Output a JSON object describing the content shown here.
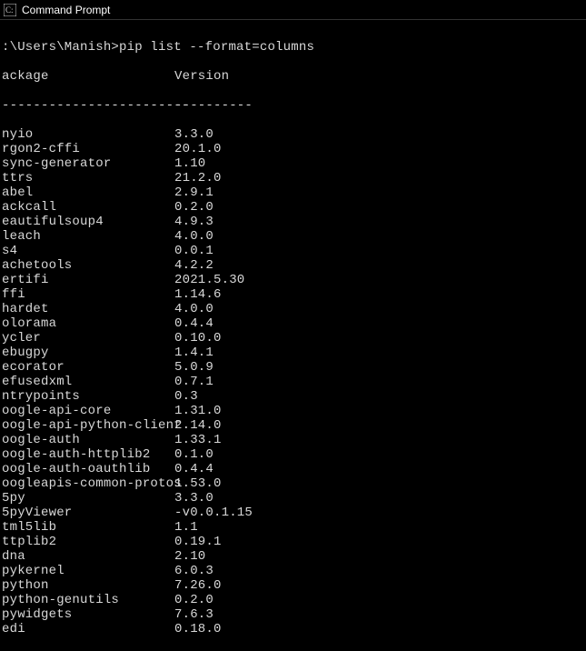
{
  "window": {
    "title": "Command Prompt"
  },
  "prompt": ":\\Users\\Manish>pip list --format=columns",
  "columns": {
    "package_header": "ackage",
    "version_header": "Version",
    "package_divider": "------------------------",
    "version_divider": "----------"
  },
  "packages": [
    {
      "name": "nyio",
      "version": "3.3.0"
    },
    {
      "name": "rgon2-cffi",
      "version": "20.1.0"
    },
    {
      "name": "sync-generator",
      "version": "1.10"
    },
    {
      "name": "ttrs",
      "version": "21.2.0"
    },
    {
      "name": "abel",
      "version": "2.9.1"
    },
    {
      "name": "ackcall",
      "version": "0.2.0"
    },
    {
      "name": "eautifulsoup4",
      "version": "4.9.3"
    },
    {
      "name": "leach",
      "version": "4.0.0"
    },
    {
      "name": "s4",
      "version": "0.0.1"
    },
    {
      "name": "achetools",
      "version": "4.2.2"
    },
    {
      "name": "ertifi",
      "version": "2021.5.30"
    },
    {
      "name": "ffi",
      "version": "1.14.6"
    },
    {
      "name": "hardet",
      "version": "4.0.0"
    },
    {
      "name": "olorama",
      "version": "0.4.4"
    },
    {
      "name": "ycler",
      "version": "0.10.0"
    },
    {
      "name": "ebugpy",
      "version": "1.4.1"
    },
    {
      "name": "ecorator",
      "version": "5.0.9"
    },
    {
      "name": "efusedxml",
      "version": "0.7.1"
    },
    {
      "name": "ntrypoints",
      "version": "0.3"
    },
    {
      "name": "oogle-api-core",
      "version": "1.31.0"
    },
    {
      "name": "oogle-api-python-client",
      "version": "2.14.0"
    },
    {
      "name": "oogle-auth",
      "version": "1.33.1"
    },
    {
      "name": "oogle-auth-httplib2",
      "version": "0.1.0"
    },
    {
      "name": "oogle-auth-oauthlib",
      "version": "0.4.4"
    },
    {
      "name": "oogleapis-common-protos",
      "version": "1.53.0"
    },
    {
      "name": "5py",
      "version": "3.3.0"
    },
    {
      "name": "5pyViewer",
      "version": "-v0.0.1.15"
    },
    {
      "name": "tml5lib",
      "version": "1.1"
    },
    {
      "name": "ttplib2",
      "version": "0.19.1"
    },
    {
      "name": "dna",
      "version": "2.10"
    },
    {
      "name": "pykernel",
      "version": "6.0.3"
    },
    {
      "name": "python",
      "version": "7.26.0"
    },
    {
      "name": "python-genutils",
      "version": "0.2.0"
    },
    {
      "name": "pywidgets",
      "version": "7.6.3"
    },
    {
      "name": "edi",
      "version": "0.18.0"
    }
  ]
}
